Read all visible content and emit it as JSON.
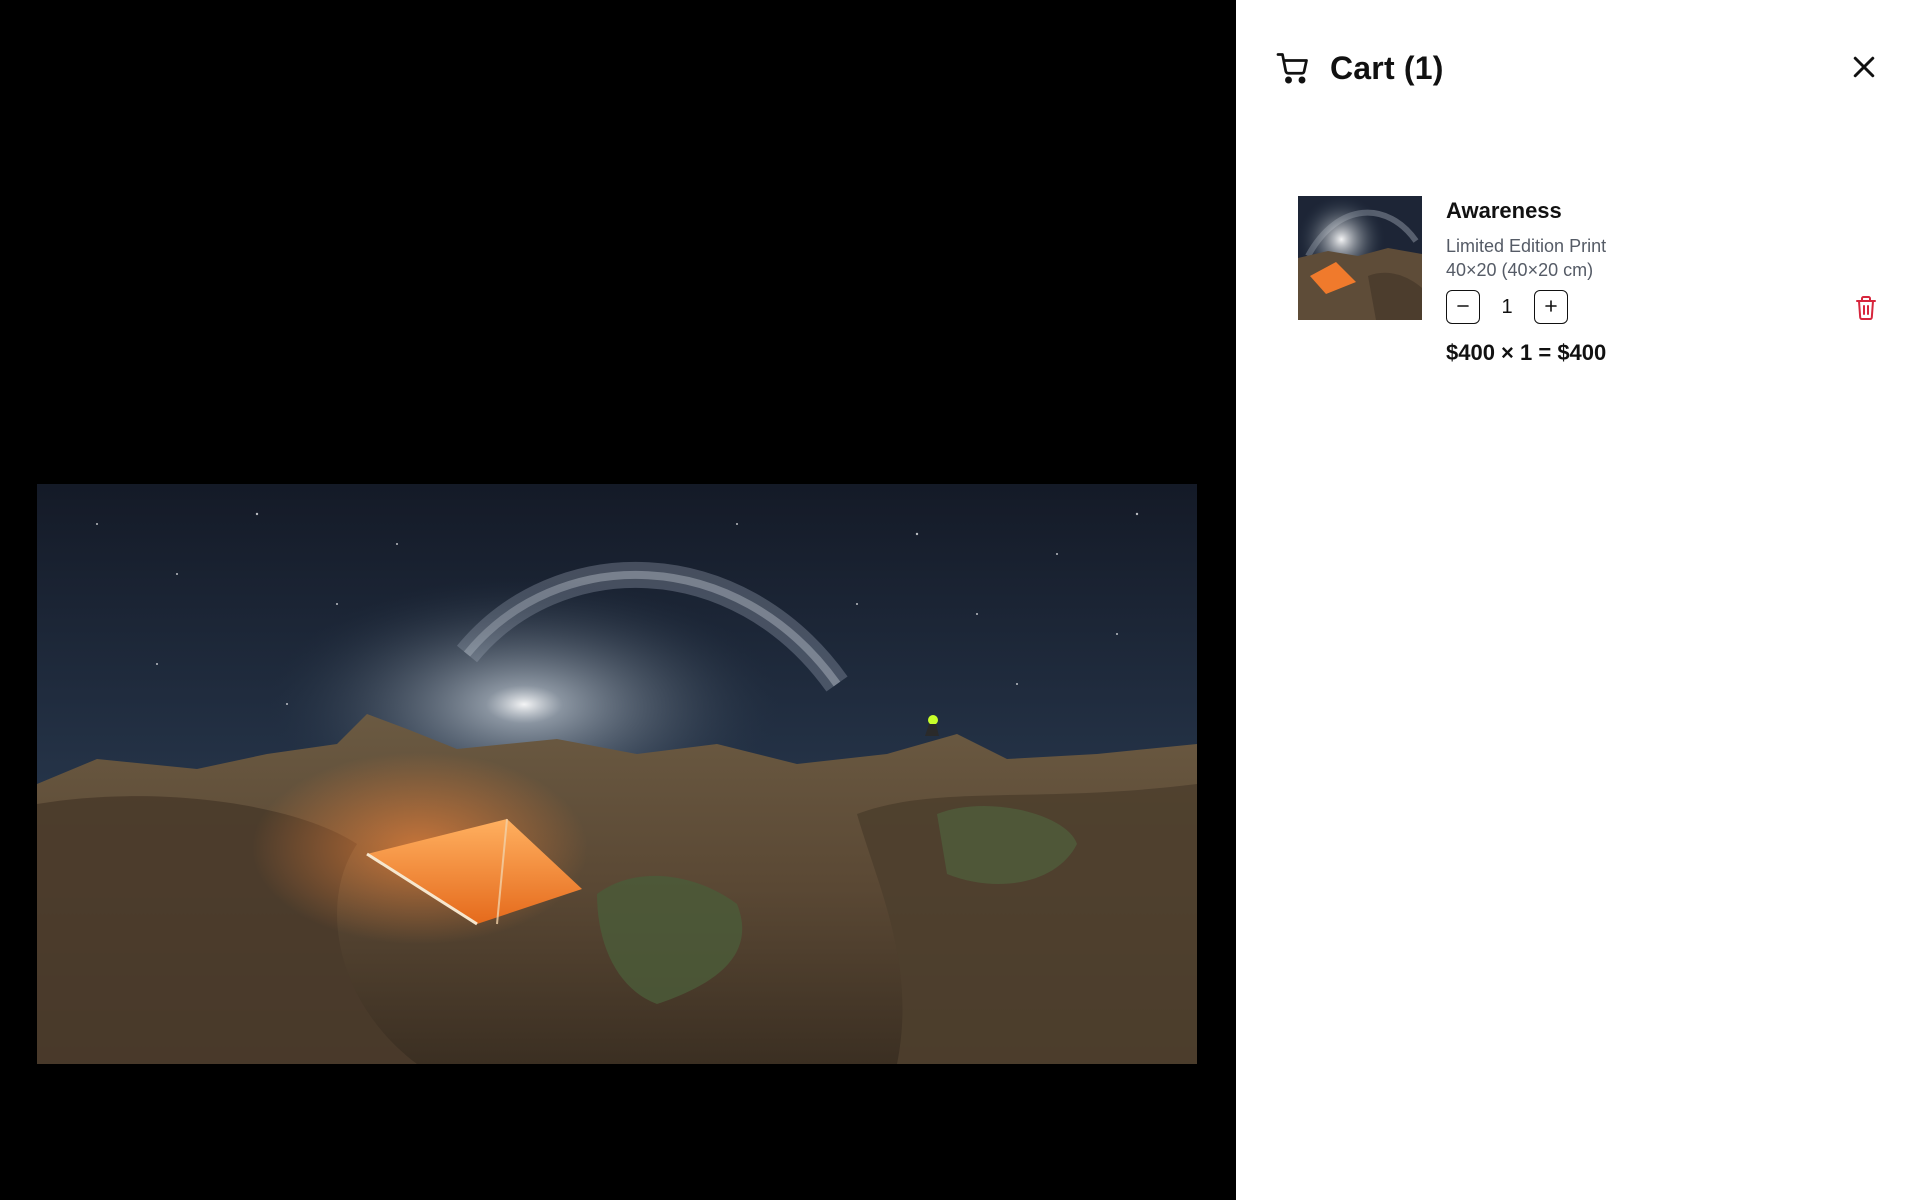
{
  "drawer": {
    "title": "Cart (1)",
    "icons": {
      "cart": "cart-icon",
      "close": "close-icon"
    }
  },
  "items": [
    {
      "name": "Awareness",
      "type": "Limited Edition Print",
      "size": "40×20 (40×20 cm)",
      "quantity": "1",
      "line_total": "$400 × 1 = $400",
      "icons": {
        "decrement": "minus-icon",
        "increment": "plus-icon",
        "remove": "trash-icon"
      }
    }
  ],
  "colors": {
    "backdrop": "#000000",
    "drawer_bg": "#ffffff",
    "text": "#111111",
    "muted_text": "#555b66",
    "danger": "#d7263d"
  }
}
